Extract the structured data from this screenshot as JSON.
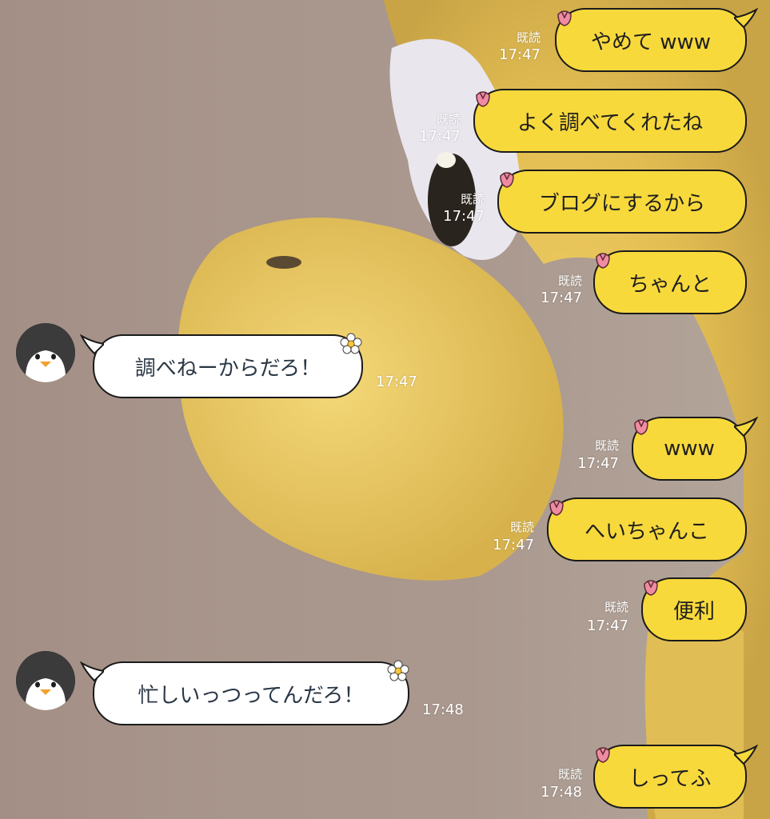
{
  "chat": {
    "messages": [
      {
        "dir": "out",
        "text": "やめて www",
        "read": "既読",
        "time": "17:47"
      },
      {
        "dir": "out",
        "text": "よく調べてくれたね",
        "read": "既読",
        "time": "17:47"
      },
      {
        "dir": "out",
        "text": "ブログにするから",
        "read": "既読",
        "time": "17:47"
      },
      {
        "dir": "out",
        "text": "ちゃんと",
        "read": "既読",
        "time": "17:47"
      },
      {
        "dir": "in",
        "text": "調べねーからだろ！",
        "time": "17:47"
      },
      {
        "dir": "out",
        "text": "www",
        "read": "既読",
        "time": "17:47"
      },
      {
        "dir": "out",
        "text": "へいちゃんこ",
        "read": "既読",
        "time": "17:47"
      },
      {
        "dir": "out",
        "text": "便利",
        "read": "既読",
        "time": "17:47"
      },
      {
        "dir": "in",
        "text": "忙しいっつってんだろ！",
        "time": "17:48"
      },
      {
        "dir": "out",
        "text": "しってふ",
        "read": "既読",
        "time": "17:48"
      }
    ]
  },
  "colors": {
    "out_bubble": "#f8d93c",
    "in_bubble": "#ffffff",
    "bubble_border": "#1a1a1a",
    "meta_text": "#ffffff"
  },
  "icons": {
    "out_decoration": "tulip-icon",
    "in_decoration": "daisy-icon",
    "avatar": "penguin-avatar"
  }
}
